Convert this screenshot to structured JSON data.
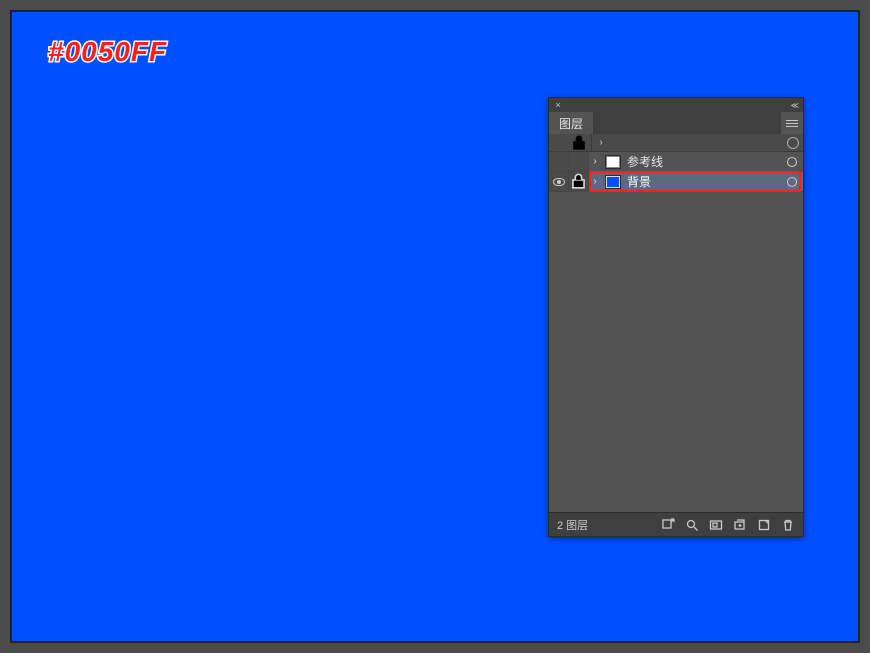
{
  "canvas": {
    "color_hex": "#0050FF",
    "bg_color": "#0050ff"
  },
  "panel": {
    "tab_label": "图层",
    "layers": [
      {
        "name": "参考线",
        "visible": false,
        "locked": true,
        "swatch": "white",
        "selected": false
      },
      {
        "name": "背景",
        "visible": true,
        "locked": true,
        "swatch": "blue",
        "selected": true
      }
    ],
    "footer_count": "2 图层",
    "footer_icons": [
      "export-icon",
      "locate-layer-icon",
      "mask-icon",
      "new-sublayer-icon",
      "new-layer-icon",
      "delete-layer-icon"
    ]
  }
}
